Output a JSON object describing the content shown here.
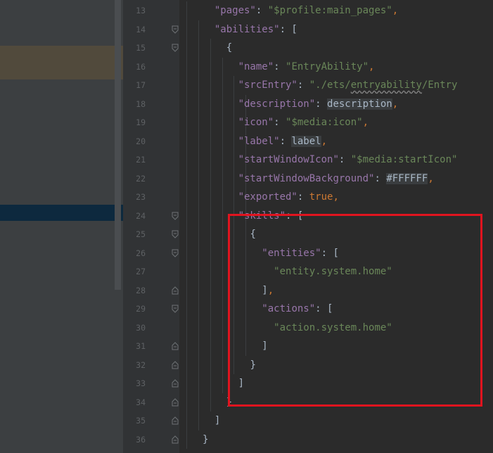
{
  "editor": {
    "line_numbers": [
      "13",
      "14",
      "15",
      "16",
      "17",
      "18",
      "19",
      "20",
      "21",
      "22",
      "23",
      "24",
      "25",
      "26",
      "27",
      "28",
      "29",
      "30",
      "31",
      "32",
      "33",
      "34",
      "35",
      "36"
    ],
    "code_lines": [
      {
        "indent": 2,
        "parts": [
          [
            "key",
            "\"pages\""
          ],
          [
            "brk",
            ": "
          ],
          [
            "str",
            "\"$profile:main_pages\""
          ],
          [
            "pun",
            ","
          ]
        ]
      },
      {
        "indent": 2,
        "parts": [
          [
            "key",
            "\"abilities\""
          ],
          [
            "brk",
            ": ["
          ]
        ]
      },
      {
        "indent": 3,
        "parts": [
          [
            "brk",
            "{"
          ]
        ]
      },
      {
        "indent": 4,
        "parts": [
          [
            "key",
            "\"name\""
          ],
          [
            "brk",
            ": "
          ],
          [
            "str",
            "\"EntryAbility\""
          ],
          [
            "pun",
            ","
          ]
        ]
      },
      {
        "indent": 4,
        "parts": [
          [
            "key",
            "\"srcEntry\""
          ],
          [
            "brk",
            ": "
          ],
          [
            "str",
            "\"./ets/"
          ],
          [
            "strsq",
            "entryability"
          ],
          [
            "str",
            "/Entry"
          ]
        ]
      },
      {
        "indent": 4,
        "parts": [
          [
            "key",
            "\"description\""
          ],
          [
            "brk",
            ": "
          ],
          [
            "ref",
            "description"
          ],
          [
            "pun",
            ","
          ]
        ]
      },
      {
        "indent": 4,
        "parts": [
          [
            "key",
            "\"icon\""
          ],
          [
            "brk",
            ": "
          ],
          [
            "str",
            "\"$media:icon\""
          ],
          [
            "pun",
            ","
          ]
        ]
      },
      {
        "indent": 4,
        "parts": [
          [
            "key",
            "\"label\""
          ],
          [
            "brk",
            ": "
          ],
          [
            "ref",
            "label"
          ],
          [
            "pun",
            ","
          ]
        ]
      },
      {
        "indent": 4,
        "parts": [
          [
            "key",
            "\"startWindowIcon\""
          ],
          [
            "brk",
            ": "
          ],
          [
            "str",
            "\"$media:startIcon\""
          ]
        ]
      },
      {
        "indent": 4,
        "parts": [
          [
            "key",
            "\"startWindowBackground\""
          ],
          [
            "brk",
            ": "
          ],
          [
            "ref",
            "#FFFFFF"
          ],
          [
            "pun",
            ","
          ]
        ]
      },
      {
        "indent": 4,
        "parts": [
          [
            "key",
            "\"exported\""
          ],
          [
            "brk",
            ": "
          ],
          [
            "kw",
            "true"
          ],
          [
            "pun",
            ","
          ]
        ]
      },
      {
        "indent": 4,
        "parts": [
          [
            "key",
            "\"skills\""
          ],
          [
            "brk",
            ": ["
          ]
        ]
      },
      {
        "indent": 5,
        "parts": [
          [
            "brk",
            "{"
          ]
        ]
      },
      {
        "indent": 6,
        "parts": [
          [
            "key",
            "\"entities\""
          ],
          [
            "brk",
            ": ["
          ]
        ]
      },
      {
        "indent": 7,
        "parts": [
          [
            "str",
            "\"entity.system.home\""
          ]
        ]
      },
      {
        "indent": 6,
        "parts": [
          [
            "brk",
            "]"
          ],
          [
            "pun",
            ","
          ]
        ]
      },
      {
        "indent": 6,
        "parts": [
          [
            "key",
            "\"actions\""
          ],
          [
            "brk",
            ": ["
          ]
        ]
      },
      {
        "indent": 7,
        "parts": [
          [
            "str",
            "\"action.system.home\""
          ]
        ]
      },
      {
        "indent": 6,
        "parts": [
          [
            "brk",
            "]"
          ]
        ]
      },
      {
        "indent": 5,
        "parts": [
          [
            "brk",
            "}"
          ]
        ]
      },
      {
        "indent": 4,
        "parts": [
          [
            "brk",
            "]"
          ]
        ]
      },
      {
        "indent": 3,
        "parts": [
          [
            "brk",
            "}"
          ]
        ]
      },
      {
        "indent": 2,
        "parts": [
          [
            "brk",
            "]"
          ]
        ]
      },
      {
        "indent": 1,
        "parts": [
          [
            "brk",
            "}"
          ]
        ]
      }
    ],
    "folds": [
      {
        "row": 1,
        "type": "open"
      },
      {
        "row": 2,
        "type": "open"
      },
      {
        "row": 11,
        "type": "open"
      },
      {
        "row": 12,
        "type": "open"
      },
      {
        "row": 13,
        "type": "open"
      },
      {
        "row": 15,
        "type": "close"
      },
      {
        "row": 16,
        "type": "open"
      },
      {
        "row": 18,
        "type": "close"
      },
      {
        "row": 19,
        "type": "close"
      },
      {
        "row": 20,
        "type": "close"
      },
      {
        "row": 21,
        "type": "close"
      },
      {
        "row": 22,
        "type": "close"
      },
      {
        "row": 23,
        "type": "close"
      }
    ]
  },
  "colors": {
    "key": "#9876aa",
    "string": "#6a8759",
    "keyword": "#cc7832",
    "highlight_box": "#e0141f"
  }
}
